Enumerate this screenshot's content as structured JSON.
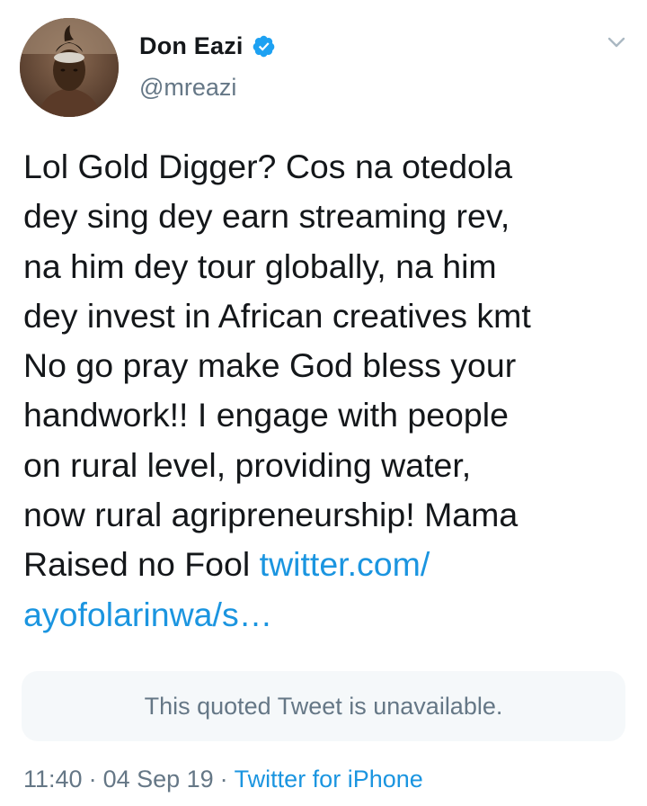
{
  "author": {
    "display_name": "Don Eazi",
    "handle": "@mreazi",
    "verified": true,
    "avatar_icon": "profile-photo"
  },
  "menu": {
    "icon": "chevron-down-icon"
  },
  "tweet": {
    "lines": [
      "Lol Gold Digger? Cos na otedola",
      "dey sing dey earn streaming rev,",
      "na him dey tour globally, na him",
      "dey invest in African creatives kmt",
      "No go pray make God bless your",
      "handwork!! I engage with people",
      "on rural level, providing water,",
      "now rural agripreneurship! Mama",
      "Raised no Fool "
    ],
    "link_part1": "twitter.com/",
    "link_part2": "ayofolarinwa/s…"
  },
  "quote": {
    "text": "This quoted Tweet is unavailable."
  },
  "meta": {
    "time": "11:40",
    "separator": "·",
    "date": "04 Sep 19",
    "source": "Twitter for iPhone"
  },
  "colors": {
    "text": "#14171a",
    "secondary": "#657786",
    "link": "#1b95e0",
    "verified_badge": "#1da1f2",
    "quote_background": "#f5f8fa"
  }
}
